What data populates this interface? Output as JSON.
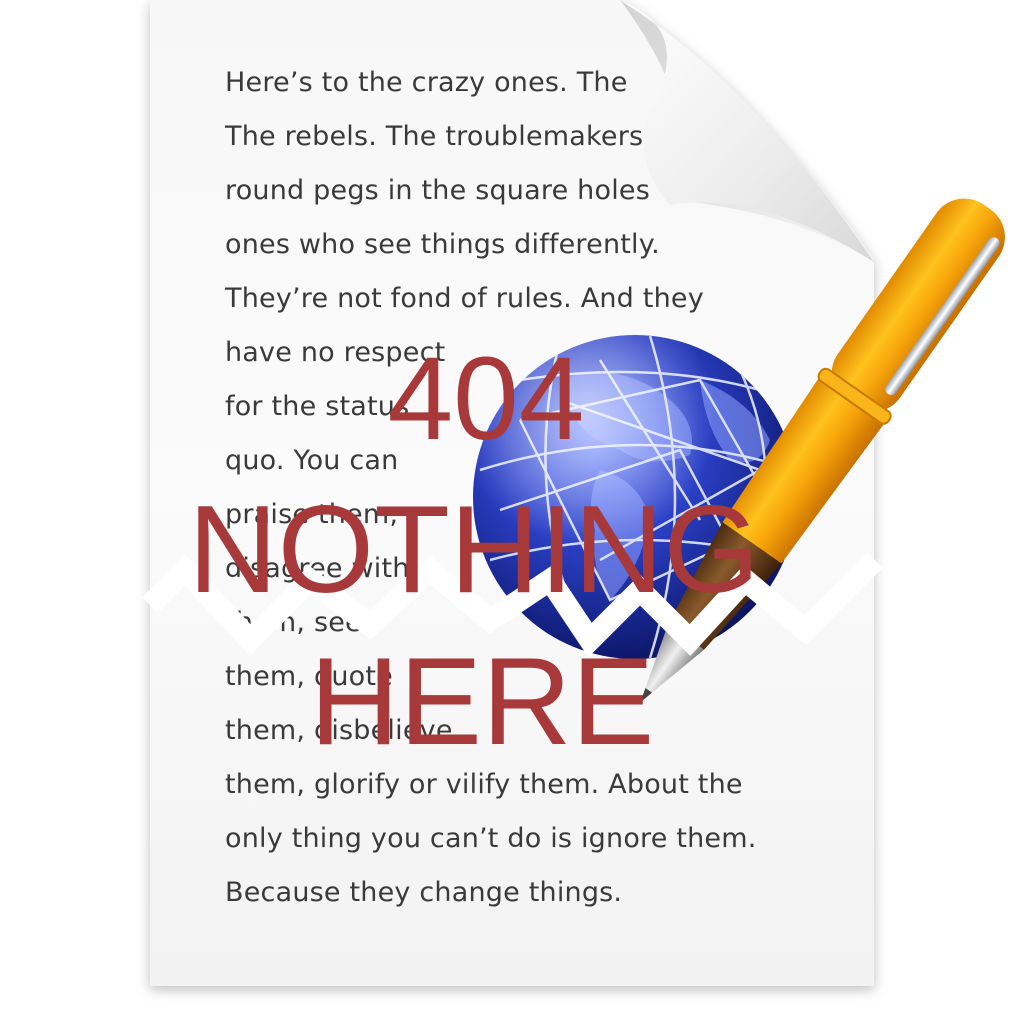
{
  "document": {
    "lines": [
      "Here’s to the crazy ones. The",
      "The rebels. The troublemakers",
      "round pegs in the square holes",
      "ones who see things differently.",
      "They’re not fond of rules. And they",
      "have no respect",
      "for the status",
      "quo. You can",
      "praise them,",
      "disagree with",
      "them, see",
      "them, quote",
      "them, disbelieve",
      "them, glorify or vilify them. About the",
      "only thing you can’t do is ignore them.",
      "Because they change things."
    ]
  },
  "error": {
    "code": "404",
    "line1": "NOTHING",
    "line2": "HERE"
  },
  "icons": {
    "globe": "globe-icon",
    "pen": "fountain-pen-icon",
    "page": "document-icon"
  },
  "colors": {
    "error_text": "#a8393a",
    "pen_body": "#f5a20a",
    "globe": "#1c2f9c",
    "body_text": "#3a3a3a"
  }
}
